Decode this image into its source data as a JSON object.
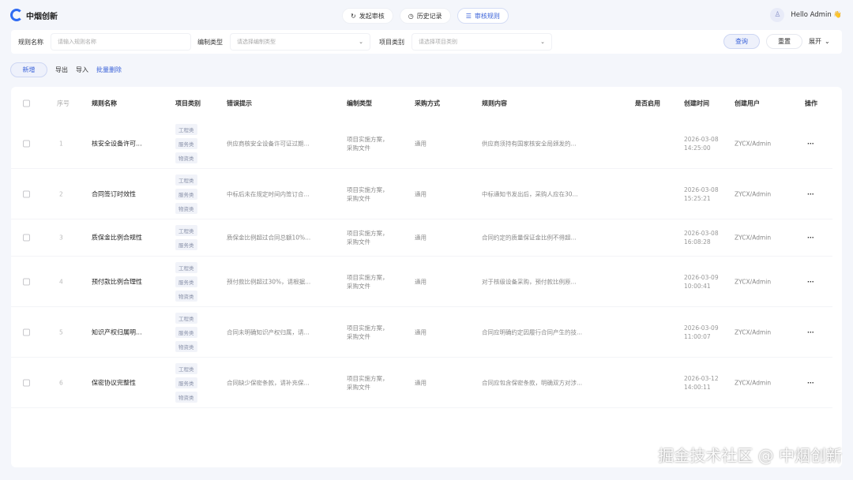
{
  "app": {
    "logo_text": "中烟创新"
  },
  "nav": [
    {
      "label": "发起审核",
      "icon": "refresh-icon",
      "active": false
    },
    {
      "label": "历史记录",
      "icon": "clock-icon",
      "active": false
    },
    {
      "label": "审核规则",
      "icon": "list-icon",
      "active": true
    }
  ],
  "user": {
    "greeting": "Hello Admin 👋"
  },
  "filter": {
    "rule_name_label": "规则名称",
    "rule_name_placeholder": "请输入规则名称",
    "compile_label": "编制类型",
    "compile_placeholder": "请选择编制类型",
    "category_label": "项目类别",
    "category_placeholder": "请选择项目类别",
    "query": "查询",
    "reset": "重置",
    "expand": "展开"
  },
  "toolbar": {
    "add": "新增",
    "export": "导出",
    "import": "导入",
    "batch_delete": "批量删除"
  },
  "table": {
    "headers": [
      "序号",
      "规则名称",
      "项目类别",
      "错误提示",
      "编制类型",
      "采购方式",
      "规则内容",
      "是否启用",
      "创建时间",
      "创建用户",
      "操作"
    ],
    "rows": [
      {
        "no": "1",
        "name": "核安全设备许可...",
        "tags": [
          "工程类",
          "服务类",
          "物资类"
        ],
        "error": "供应商核安全设备许可证过期...",
        "compile1": "项目实施方案，",
        "compile2": "采购文件",
        "purchase": "通用",
        "content": "供应商须持有国家核安全局颁发的...",
        "enabled": true,
        "date": "2026-03-08",
        "time": "14:25:00",
        "user": "ZYCX/Admin"
      },
      {
        "no": "2",
        "name": "合同签订时效性",
        "tags": [
          "工程类",
          "服务类",
          "物资类"
        ],
        "error": "中标后未在规定时间内签订合...",
        "compile1": "项目实施方案，",
        "compile2": "采购文件",
        "purchase": "通用",
        "content": "中标通知书发出后，采购人应在30...",
        "enabled": true,
        "date": "2026-03-08",
        "time": "15:25:21",
        "user": "ZYCX/Admin"
      },
      {
        "no": "3",
        "name": "质保金比例合规性",
        "tags": [
          "工程类",
          "服务类"
        ],
        "error": "质保金比例超过合同总额10%...",
        "compile1": "项目实施方案，",
        "compile2": "采购文件",
        "purchase": "通用",
        "content": "合同约定的质量保证金比例不得超...",
        "enabled": false,
        "date": "2026-03-08",
        "time": "16:08:28",
        "user": "ZYCX/Admin"
      },
      {
        "no": "4",
        "name": "预付款比例合理性",
        "tags": [
          "工程类",
          "服务类",
          "物资类"
        ],
        "error": "预付款比例超过30%，请根据...",
        "compile1": "项目实施方案，",
        "compile2": "采购文件",
        "purchase": "通用",
        "content": "对于核级设备采购，预付款比例原...",
        "enabled": true,
        "date": "2026-03-09",
        "time": "10:00:41",
        "user": "ZYCX/Admin"
      },
      {
        "no": "5",
        "name": "知识产权归属明...",
        "tags": [
          "工程类",
          "服务类",
          "物资类"
        ],
        "error": "合同未明确知识产权归属，请...",
        "compile1": "项目实施方案，",
        "compile2": "采购文件",
        "purchase": "通用",
        "content": "合同应明确约定因履行合同产生的技...",
        "enabled": true,
        "date": "2026-03-09",
        "time": "11:00:07",
        "user": "ZYCX/Admin"
      },
      {
        "no": "6",
        "name": "保密协议完整性",
        "tags": [
          "工程类",
          "服务类",
          "物资类"
        ],
        "error": "合同缺少保密条款，请补充保...",
        "compile1": "项目实施方案，",
        "compile2": "采购文件",
        "purchase": "通用",
        "content": "合同应包含保密条款，明确双方对涉...",
        "enabled": true,
        "date": "2026-03-12",
        "time": "14:00:11",
        "user": "ZYCX/Admin"
      }
    ]
  },
  "watermark": "掘金技术社区 @ 中烟创新",
  "colors": {
    "accent": "#3b63d9",
    "toggle_on": "#52c41a"
  }
}
